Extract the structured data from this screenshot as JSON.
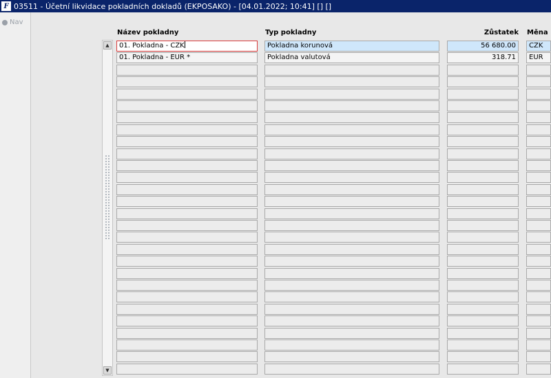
{
  "window": {
    "title": "03511 - Účetní likvidace pokladních dokladů (EKPOSAKO) - [04.01.2022; 10:41] [] []",
    "icon": "app-logo-icon"
  },
  "left_panel": {
    "nav_label": "Nav"
  },
  "table": {
    "headers": {
      "name": "Název pokladny",
      "type": "Typ pokladny",
      "balance": "Zůstatek",
      "currency": "Měna"
    },
    "rows": [
      {
        "name": "01. Pokladna - CZK",
        "type": "Pokladna korunová",
        "balance": "56 680.00",
        "currency": "CZK"
      },
      {
        "name": "01. Pokladna - EUR *",
        "type": "Pokladna valutová",
        "balance": "318.71",
        "currency": "EUR"
      }
    ],
    "selected_index": 0,
    "empty_rows": 26
  },
  "colors": {
    "titlebar": "#0a246a",
    "selection": "#cfe7fb",
    "focus_border": "#d83a3a"
  }
}
